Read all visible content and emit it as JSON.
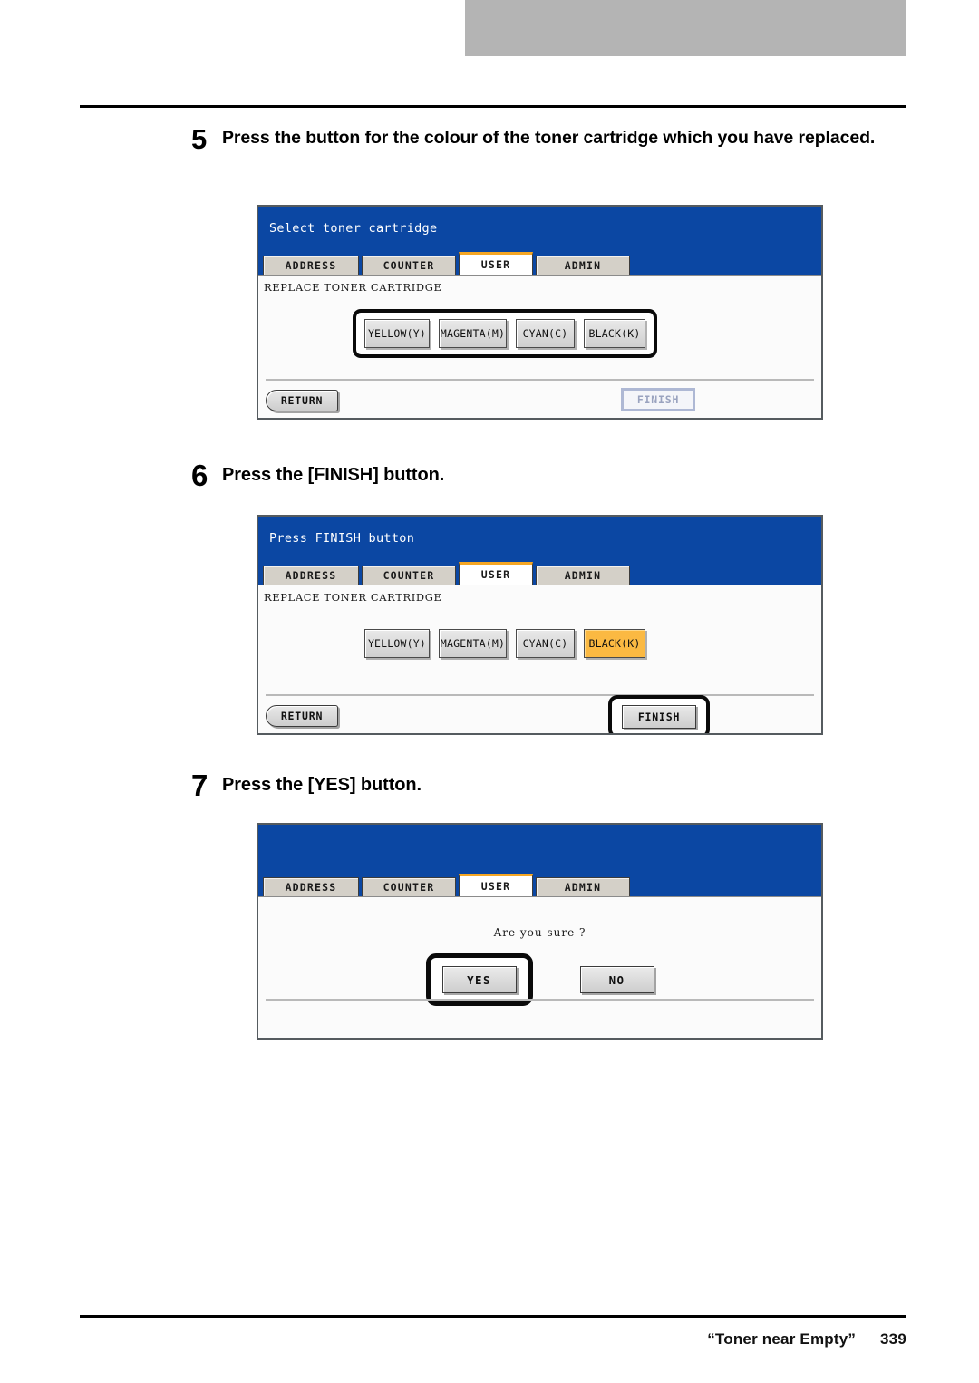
{
  "document": {
    "footer_text": "“Toner near Empty”",
    "page_number": "339"
  },
  "steps": [
    {
      "number": "5",
      "text": "Press the button for the colour of the toner cartridge which you have replaced."
    },
    {
      "number": "6",
      "text": "Press the [FINISH] button."
    },
    {
      "number": "7",
      "text": "Press the [YES] button."
    }
  ],
  "colors": {
    "panel_blue": "#0b47a3",
    "tab_active_accent": "#f5a623",
    "selected_button": "#fbb942",
    "top_bar_gray": "#b4b4b4",
    "disabled_text": "#9aa3bf"
  },
  "tabs": [
    {
      "label": "ADDRESS",
      "active": false
    },
    {
      "label": "COUNTER",
      "active": false
    },
    {
      "label": "USER",
      "active": true
    },
    {
      "label": "ADMIN",
      "active": false
    }
  ],
  "panel1": {
    "title": "Select toner cartridge",
    "subtitle": "REPLACE TONER CARTRIDGE",
    "toner_buttons": [
      {
        "label": "YELLOW(Y)",
        "selected": false
      },
      {
        "label": "MAGENTA(M)",
        "selected": false
      },
      {
        "label": "CYAN(C)",
        "selected": false
      },
      {
        "label": "BLACK(K)",
        "selected": false
      }
    ],
    "return_label": "RETURN",
    "finish_label": "FINISH",
    "finish_enabled": false
  },
  "panel2": {
    "title": "Press FINISH button",
    "subtitle": "REPLACE TONER CARTRIDGE",
    "toner_buttons": [
      {
        "label": "YELLOW(Y)",
        "selected": false
      },
      {
        "label": "MAGENTA(M)",
        "selected": false
      },
      {
        "label": "CYAN(C)",
        "selected": false
      },
      {
        "label": "BLACK(K)",
        "selected": true
      }
    ],
    "return_label": "RETURN",
    "finish_label": "FINISH",
    "finish_enabled": true
  },
  "panel3": {
    "title": "",
    "message": "Are you sure ?",
    "yes_label": "YES",
    "no_label": "NO"
  }
}
